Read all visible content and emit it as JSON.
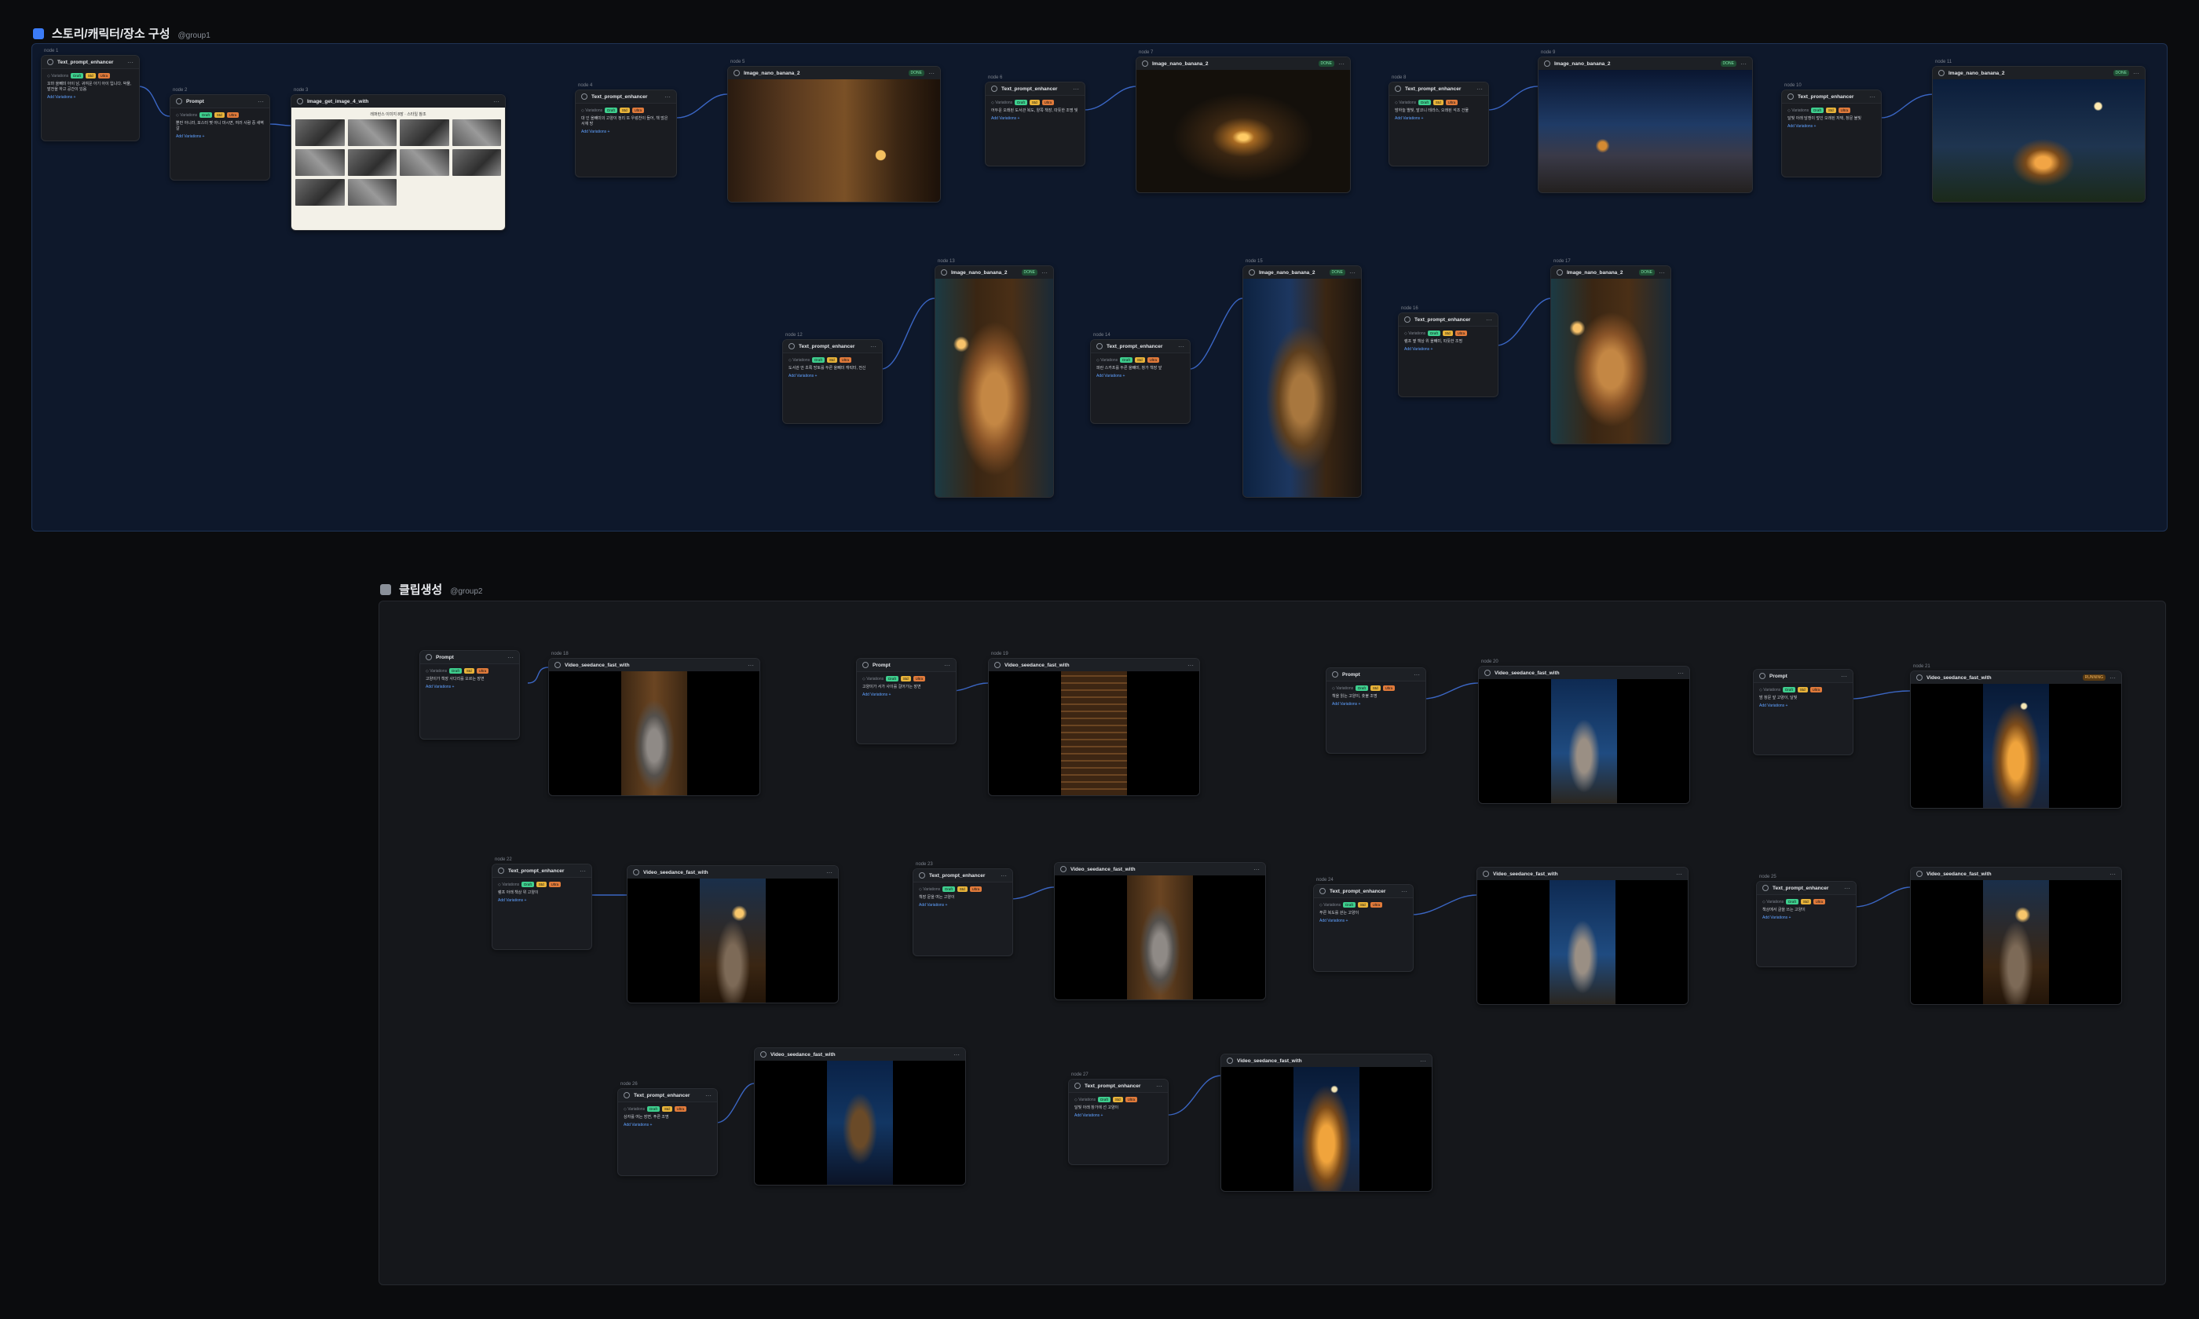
{
  "groups": [
    {
      "id": "group1",
      "title": "스토리/캐릭터/장소 구성",
      "handle": "@group1",
      "color": "#3b7bf6"
    },
    {
      "id": "group2",
      "title": "클립생성",
      "handle": "@group2",
      "color": "#8a9099"
    }
  ],
  "node_types": {
    "text_prompt": "Text_prompt_enhancer",
    "prompt": "Prompt",
    "image_get": "Image_get_image_4_with",
    "image_nano": "Image_nano_banana_2",
    "video_seedance": "Video_seedance_fast_with"
  },
  "common": {
    "tag_label": "◇ Variations",
    "tags": [
      "Draft",
      "Std",
      "Ultra"
    ],
    "link": "Add Variations +",
    "done_badge": "DONE",
    "running_badge": "RUNNING",
    "menu_glyph": "···"
  },
  "prompts": {
    "p1": "꼬마 올빼미 아이 남, 귀여운 아기 아이 입니다. 박물, 발전을 하고 공간이 있음",
    "p2": "뿐만 아니라, 포스터 몇 아니 마시면, 여러 사람 중 새벽 갈",
    "p3": "대 인 올빼미의 고양이 정리 또 우렁찬이 들어, 책 많은 서재 방",
    "p4": "어두운 오래된 도서관 복도, 양쪽 책장, 따뜻한 조명 빛",
    "p5": "밤하늘 별빛, 발코니 테라스, 오래된 석조 건물",
    "p6": "달빛 아래 담쟁이 덮인 오래된 저택, 창문 불빛",
    "p7": "도서관 안 초록 망토를 두른 올빼미 캐릭터, 전신",
    "p8": "파란 스카프를 두른 올빼미, 창가 책장 앞",
    "p9": "램프 옆 책상 위 올빼미, 따뜻한 조명",
    "c1": "고양이가 책장 사다리를 오르는 장면",
    "c2": "고양이가 서가 사이를 걸어가는 장면",
    "c3": "책을 읽는 고양이, 촛불 조명",
    "c4": "밤 창문 앞 고양이, 달빛",
    "c5": "램프 아래 책상 위 고양이",
    "c6": "책장 문을 여는 고양이",
    "c7": "푸른 복도를 걷는 고양이",
    "c8": "책상에서 글을 쓰는 고양이",
    "c9": "상자를 여는 장면, 푸른 조명",
    "c10": "달빛 아래 창가에 선 고양이"
  },
  "thumbs_caption": "레퍼런스 이미지 8장 · 스타일 참조",
  "node_ids": {
    "n_tp1": "node 1",
    "n_pr1": "node 2",
    "n_ig": "node 3",
    "n_tp2": "node 4",
    "n_im1": "node 5",
    "n_tp3": "node 6",
    "n_im2": "node 7",
    "n_tp4": "node 8",
    "n_im3": "node 9",
    "n_tp5": "node 10",
    "n_im4": "node 11",
    "n_tp6": "node 12",
    "n_im5": "node 13",
    "n_tp7": "node 14",
    "n_im6": "node 15",
    "n_tp8": "node 16",
    "n_im7": "node 17",
    "v1": "node 18",
    "v2": "node 19",
    "v3": "node 20",
    "v4": "node 21",
    "v5": "node 22",
    "v6": "node 23",
    "v7": "node 24",
    "v8": "node 25",
    "v9": "node 26",
    "v10": "node 27"
  }
}
